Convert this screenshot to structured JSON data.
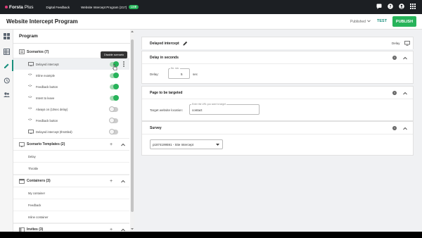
{
  "topbar": {
    "brand_name": "Forsta",
    "brand_suffix": "Plus",
    "nav_digital": "Digital Feedback",
    "nav_program": "Website Intercept Program (217)",
    "live_badge": "LIVE",
    "icons": [
      "chat-icon",
      "help-icon",
      "account-icon",
      "apps-grid-icon"
    ]
  },
  "titlebar": {
    "title": "Website Intercept Program",
    "status": "Published",
    "test_label": "TEST",
    "publish_label": "PUBLISH"
  },
  "rail": {
    "icons": [
      "dashboard-icon",
      "table-icon",
      "edit-icon",
      "history-icon",
      "people-icon"
    ],
    "active": "edit-icon"
  },
  "program": {
    "title": "Program",
    "scenarios": {
      "label": "Scenarios (7)",
      "tooltip": "Disable scenario",
      "items": [
        {
          "label": "Delayed intercept",
          "icon": "monitor-icon",
          "on": true,
          "selected": true
        },
        {
          "label": "Inline example",
          "icon": "code-icon",
          "on": true,
          "selected": false
        },
        {
          "label": "Feedback button",
          "icon": "code-icon",
          "on": true,
          "selected": false
        },
        {
          "label": "Intent to leave",
          "icon": "code-icon",
          "on": true,
          "selected": false
        },
        {
          "label": "Always on (10sec delay)",
          "icon": "code-icon",
          "on": false,
          "selected": false
        },
        {
          "label": "Feedback button",
          "icon": "code-icon",
          "on": false,
          "selected": false
        },
        {
          "label": "Delayed intercept (throttled)",
          "icon": "monitor-icon",
          "on": false,
          "selected": false
        }
      ]
    },
    "templates": {
      "label": "Scenario Templates (2)",
      "items": [
        "Delay",
        "Throttle"
      ]
    },
    "containers": {
      "label": "Containers (3)",
      "items": [
        "My container",
        "Feedback",
        "Inline container"
      ]
    },
    "invites": {
      "label": "Invites (3)"
    }
  },
  "detail": {
    "header": {
      "title": "Delayed intercept",
      "type_label": "Delay"
    },
    "delay_card": {
      "title": "Delay in seconds",
      "field_label": "Delay:",
      "legend": "No. sec.",
      "value": "5",
      "unit": "sec"
    },
    "target_card": {
      "title": "Page to be targeted",
      "field_label": "Target website location:",
      "legend": "Enter the URL you want to target",
      "value": "contact"
    },
    "survey_card": {
      "title": "Survey",
      "selected": "p1874199591 - Site Intercept"
    }
  }
}
